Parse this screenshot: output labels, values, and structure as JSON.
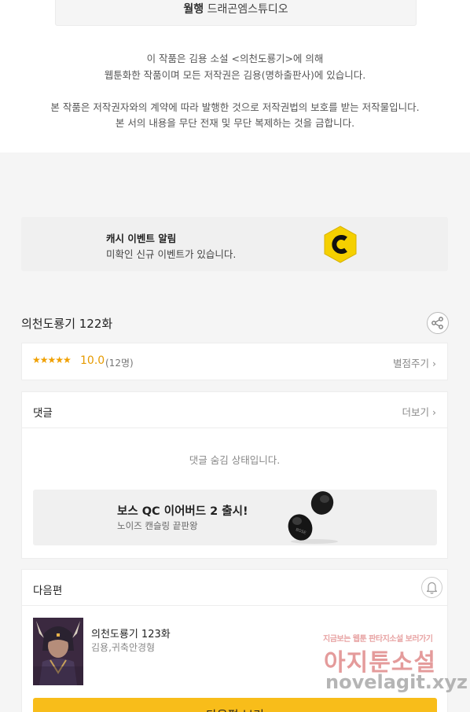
{
  "credits": {
    "bold": "월행",
    "rest": " 드래곤엠스튜디오"
  },
  "copyright": {
    "line1": "이 작품은 김용 소설 <의천도룡기>에 의해",
    "line2": "웹툰화한 작품이며 모든 저작권은 김용(명하출판사)에 있습니다.",
    "line3": "본 작품은 저작권자와의 계약에 따라 발행한 것으로 저작권법의 보호를 받는 저작물입니다.",
    "line4": "본 서의 내용을 무단 전재 및 무단 복제하는 것을 금합니다."
  },
  "event_banner": {
    "title": "캐시 이벤트 알림",
    "subtitle": "미확인 신규 이벤트가 있습니다.",
    "icon": "coin-c-icon"
  },
  "episode": {
    "title": "의천도룡기 122화"
  },
  "rating": {
    "stars": "★★★★★",
    "score": "10.0",
    "count": "(12명)",
    "rate_link": "별점주기 ›",
    "star_color": "#f0a000"
  },
  "comments": {
    "header": "댓글",
    "more_link": "더보기 ›",
    "hidden_message": "댓글 숨김 상태입니다.",
    "ad": {
      "title": "보스 QC 이어버드 2 출시!",
      "subtitle": "노이즈 캔슬링 끝판왕"
    }
  },
  "next_episode": {
    "header": "다음편",
    "title": "의천도룡기 123화",
    "author": "김용,귀축안경형",
    "button_label": "다음편 보기",
    "button_color": "#f8bd1a"
  },
  "watermark": {
    "tagline": "지금보는 웹툰 판타지소설 보러가기",
    "name": "아지툰소설",
    "url": "novelagit.xyz"
  }
}
